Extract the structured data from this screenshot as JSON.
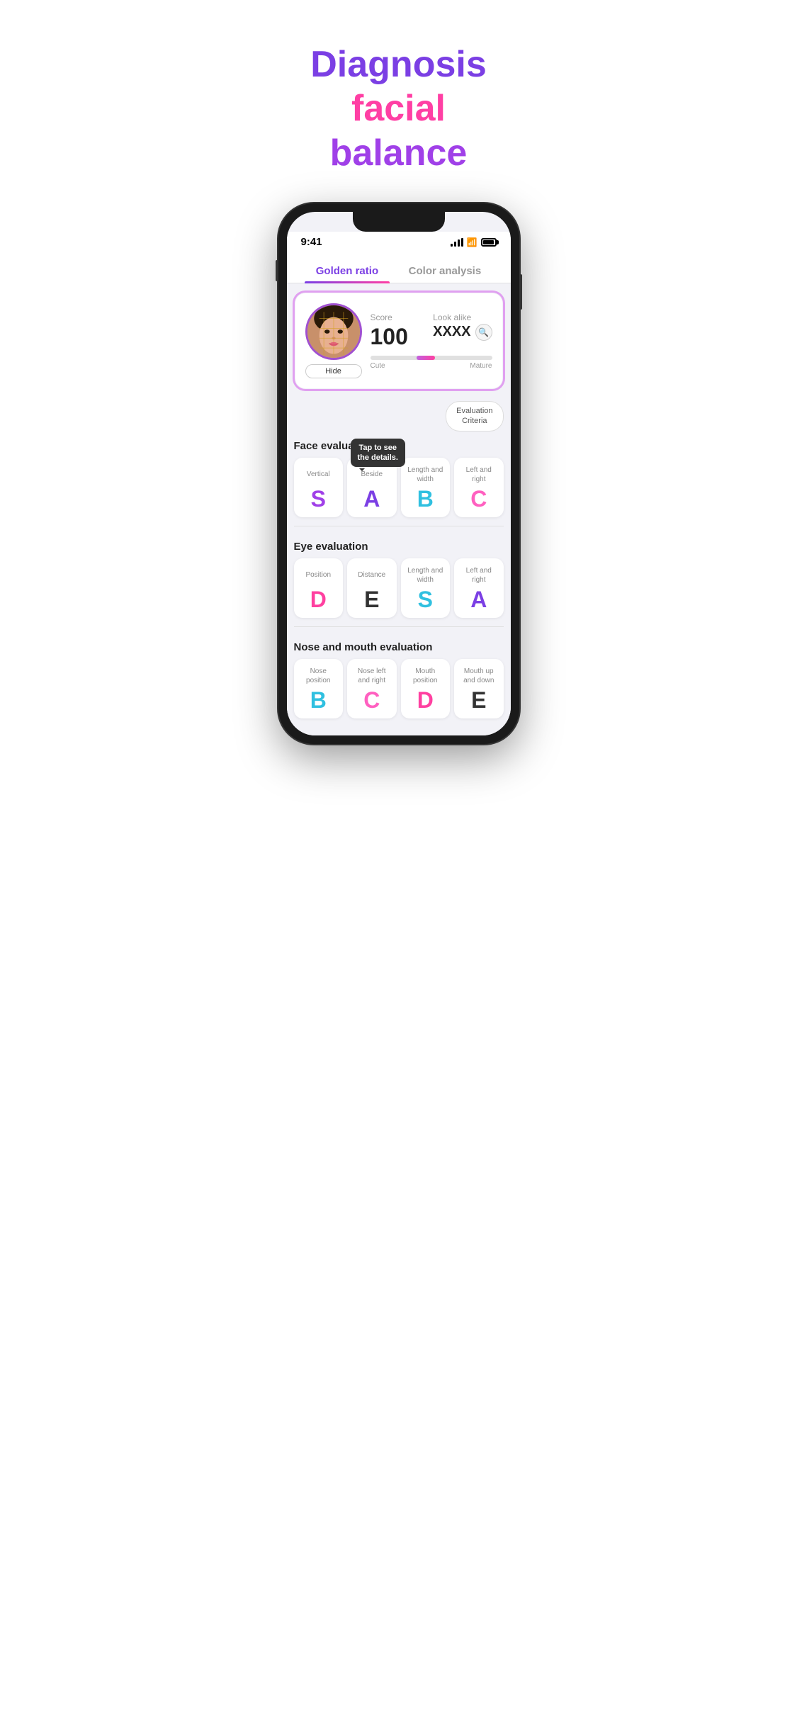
{
  "hero": {
    "line1": "Diagnosis facial",
    "line2": "balance",
    "word1": "Diagnosis",
    "word2": "facial",
    "word3": "balance"
  },
  "status_bar": {
    "time": "9:41",
    "signal": "●●●",
    "wifi": "WiFi",
    "battery": "Battery"
  },
  "tabs": [
    {
      "label": "Golden ratio",
      "active": true
    },
    {
      "label": "Color analysis",
      "active": false
    }
  ],
  "score_card": {
    "score_label": "Score",
    "score_value": "100",
    "look_alike_label": "Look alike",
    "look_alike_value": "XXXX",
    "hide_btn": "Hide",
    "cute_label": "Cute",
    "mature_label": "Mature"
  },
  "eval_criteria_btn": "Evaluation\nCriteria",
  "tooltip": "Tap to see\nthe details.",
  "face_eval": {
    "title": "Face evaluation",
    "cards": [
      {
        "label": "Vertical",
        "grade": "S",
        "color_class": "grade-s"
      },
      {
        "label": "Beside",
        "grade": "A",
        "color_class": "grade-a"
      },
      {
        "label": "Length and width",
        "grade": "B",
        "color_class": "grade-b"
      },
      {
        "label": "Left and right",
        "grade": "C",
        "color_class": "grade-c"
      }
    ]
  },
  "eye_eval": {
    "title": "Eye evaluation",
    "cards": [
      {
        "label": "Position",
        "grade": "D",
        "color_class": "grade-d"
      },
      {
        "label": "Distance",
        "grade": "E",
        "color_class": "grade-e"
      },
      {
        "label": "Length and width",
        "grade": "S",
        "color_class": "grade-b"
      },
      {
        "label": "Left and right",
        "grade": "A",
        "color_class": "grade-a"
      }
    ]
  },
  "nose_mouth_eval": {
    "title": "Nose and mouth evaluation",
    "cards": [
      {
        "label": "Nose position",
        "grade": "B",
        "color_class": "grade-b"
      },
      {
        "label": "Nose left and right",
        "grade": "C",
        "color_class": "grade-c"
      },
      {
        "label": "Mouth position",
        "grade": "D",
        "color_class": "grade-d"
      },
      {
        "label": "Mouth up and down",
        "grade": "E",
        "color_class": "grade-e"
      }
    ]
  }
}
